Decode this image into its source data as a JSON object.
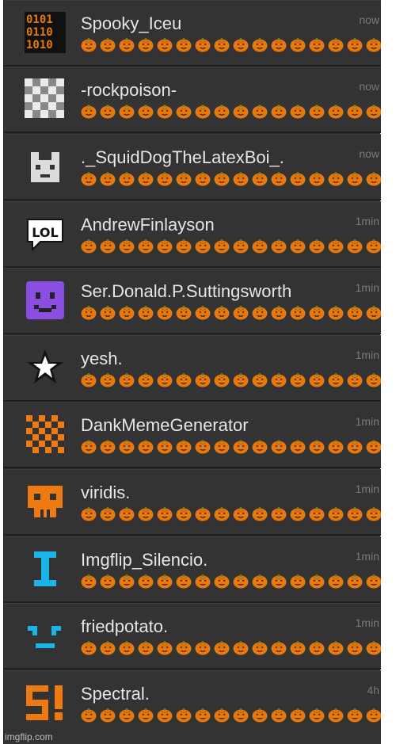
{
  "messages": [
    {
      "name": "Spooky_Iceu",
      "time": "now",
      "avatar_icon": "binary-code-icon",
      "pumpkins": 16
    },
    {
      "name": "-rockpoison-",
      "time": "now",
      "avatar_icon": "checkerboard-icon",
      "pumpkins": 16
    },
    {
      "name": "._SquidDogTheLatexBoi_.",
      "time": "now",
      "avatar_icon": "pixel-dog-icon",
      "pumpkins": 16
    },
    {
      "name": "AndrewFinlayson",
      "time": "1min",
      "avatar_icon": "lol-speech-bubble-icon",
      "avatar_text": "LOL",
      "pumpkins": 16
    },
    {
      "name": "Ser.Donald.P.Suttingsworth",
      "time": "1min",
      "avatar_icon": "purple-smiley-icon",
      "pumpkins": 16
    },
    {
      "name": "yesh.",
      "time": "1min",
      "avatar_icon": "star-icon",
      "pumpkins": 16
    },
    {
      "name": "DankMemeGenerator",
      "time": "1min",
      "avatar_icon": "orange-checkerboard-icon",
      "pumpkins": 16
    },
    {
      "name": "viridis.",
      "time": "1min",
      "avatar_icon": "orange-skull-icon",
      "pumpkins": 16
    },
    {
      "name": "Imgflip_Silencio.",
      "time": "1min",
      "avatar_icon": "letter-i-icon",
      "pumpkins": 16
    },
    {
      "name": "friedpotato.",
      "time": "1min",
      "avatar_icon": "blue-face-icon",
      "pumpkins": 16
    },
    {
      "name": "Spectral.",
      "time": "4h",
      "avatar_icon": "s-exclamation-icon",
      "pumpkins": 16
    }
  ],
  "message_icon": "pumpkin-emoji-icon",
  "colors": {
    "row_bg": "#333333",
    "name": "#e6e6e6",
    "time": "#7a7a7a",
    "pumpkin": "#e8790f"
  },
  "watermark": "imgflip.com"
}
